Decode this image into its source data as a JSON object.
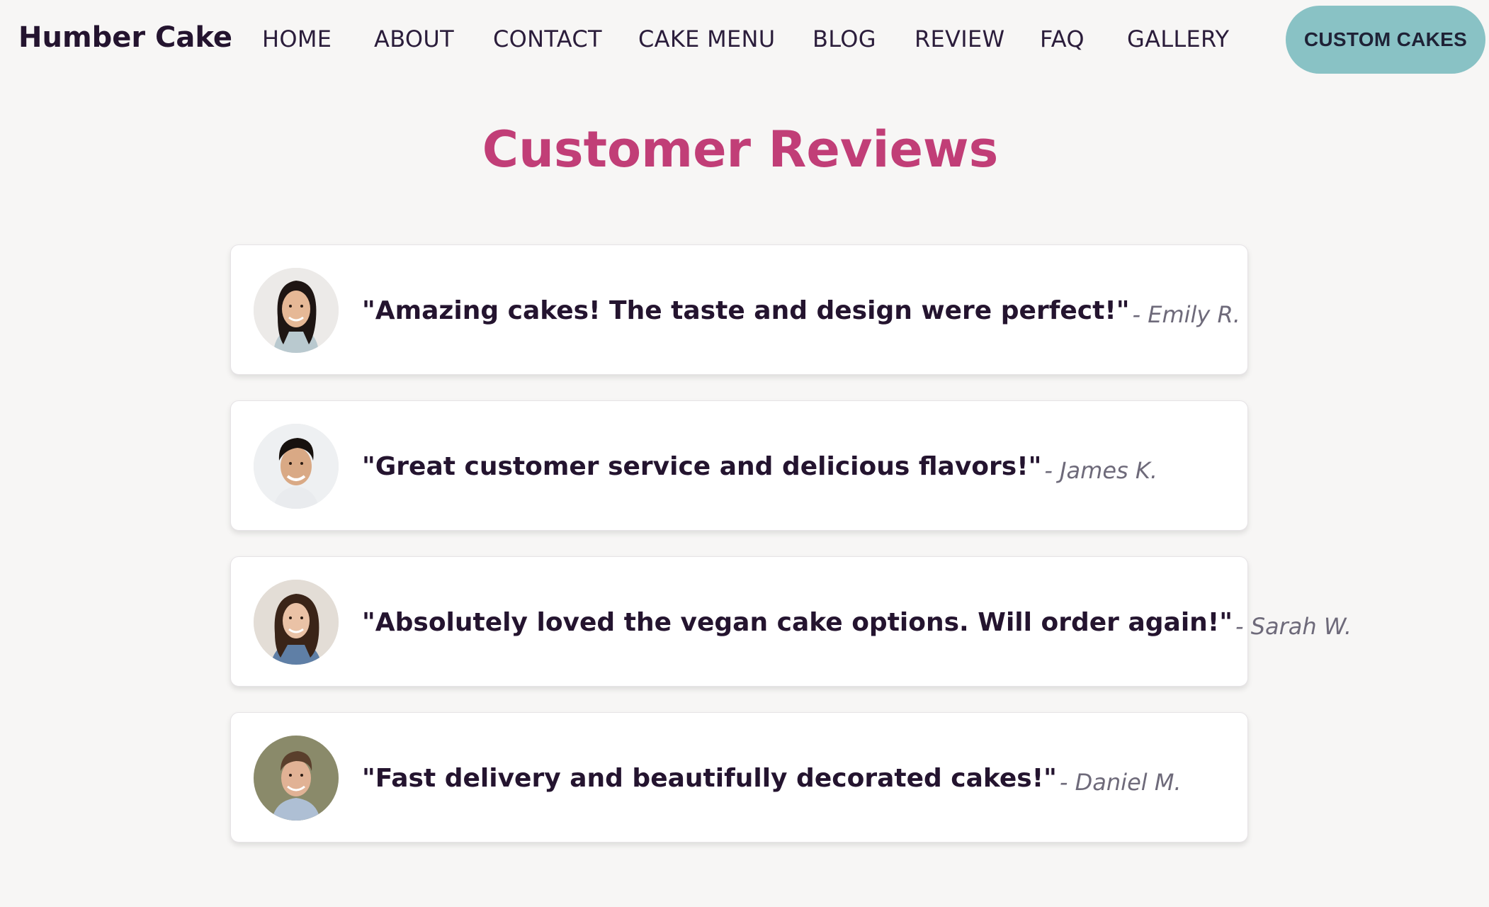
{
  "header": {
    "logo": "Humber Cake",
    "nav": {
      "home": "HOME",
      "about": "ABOUT",
      "contact": "CONTACT",
      "cake_menu": "CAKE MENU",
      "blog": "BLOG",
      "review": "REVIEW",
      "faq": "FAQ",
      "gallery": "GALLERY"
    },
    "cta_label": "CUSTOM CAKES"
  },
  "main": {
    "title": "Customer Reviews",
    "reviews": [
      {
        "quote": "\"Amazing cakes! The taste and design were perfect!\"",
        "author": "- Emily R."
      },
      {
        "quote": "\"Great customer service and delicious flavors!\"",
        "author": "- James K."
      },
      {
        "quote": "\"Absolutely loved the vegan cake options. Will order again!\"",
        "author": "- Sarah W."
      },
      {
        "quote": "\"Fast delivery and beautifully decorated cakes!\"",
        "author": "- Daniel M."
      }
    ]
  },
  "colors": {
    "background": "#f7f6f5",
    "title": "#c13e77",
    "text": "#24142f",
    "author": "#6e6a7a",
    "cta": "#89c2c5"
  }
}
